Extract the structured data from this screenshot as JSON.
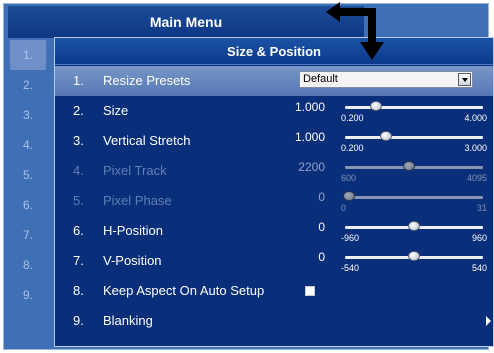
{
  "main_menu": {
    "title": "Main Menu",
    "numbers": [
      "1.",
      "2.",
      "3.",
      "4.",
      "5.",
      "6.",
      "7.",
      "8.",
      "9."
    ]
  },
  "size_position": {
    "title": "Size & Position",
    "items": [
      {
        "num": "1.",
        "label": "Resize Presets",
        "control": "dropdown",
        "selected_value": "Default",
        "state": "selected"
      },
      {
        "num": "2.",
        "label": "Size",
        "control": "slider",
        "value": "1.000",
        "min": "0.200",
        "max": "4.000",
        "level": 0.2105,
        "state": "enabled"
      },
      {
        "num": "3.",
        "label": "Vertical Stretch",
        "control": "slider",
        "value": "1.000",
        "min": "0.200",
        "max": "3.000",
        "level": 0.2857,
        "state": "enabled"
      },
      {
        "num": "4.",
        "label": "Pixel Track",
        "control": "slider",
        "value": "2200",
        "min": "600",
        "max": "4095",
        "level": 0.4578,
        "state": "disabled"
      },
      {
        "num": "5.",
        "label": "Pixel Phase",
        "control": "slider",
        "value": "0",
        "min": "0",
        "max": "31",
        "level": 0.0,
        "state": "disabled"
      },
      {
        "num": "6.",
        "label": "H-Position",
        "control": "slider",
        "value": "0",
        "min": "-960",
        "max": "960",
        "level": 0.5,
        "state": "enabled"
      },
      {
        "num": "7.",
        "label": "V-Position",
        "control": "slider",
        "value": "0",
        "min": "-540",
        "max": "540",
        "level": 0.5,
        "state": "enabled"
      },
      {
        "num": "8.",
        "label": "Keep Aspect On Auto Setup",
        "control": "checkbox",
        "checked": false,
        "state": "enabled"
      },
      {
        "num": "9.",
        "label": "Blanking",
        "control": "submenu",
        "state": "enabled"
      }
    ]
  },
  "colors": {
    "main_panel": "#3f6fb5",
    "sub_panel": "#0a2f7a",
    "title_bar": "#0d3784",
    "selected_row": "#6a89c0",
    "disabled_text": "#5f7db6"
  },
  "icons": {
    "callout": "bent-arrow-icon",
    "dropdown": "chevron-down-icon",
    "submenu": "triangle-right-icon"
  }
}
